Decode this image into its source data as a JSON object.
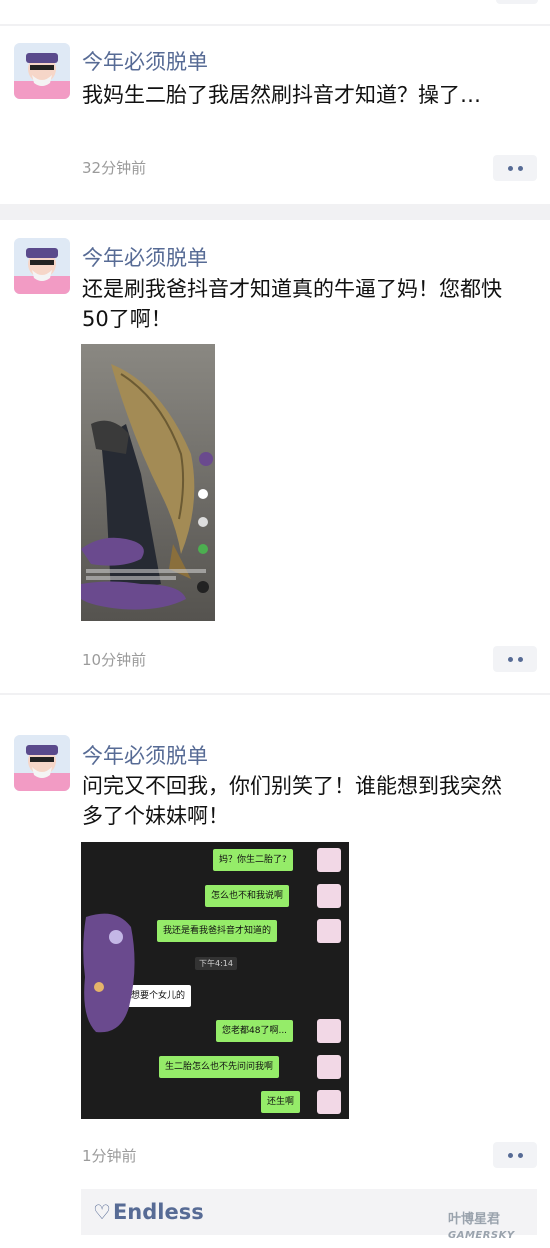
{
  "posts": [
    {
      "nickname": "今年必须脱单",
      "text": "我妈生二胎了我居然刷抖音才知道？操了…",
      "time": "32分钟前"
    },
    {
      "nickname": "今年必须脱单",
      "text": "还是刷我爸抖音才知道真的牛逼了妈！您都快50了啊！",
      "time": "10分钟前"
    },
    {
      "nickname": "今年必须脱单",
      "text": "问完又不回我，你们别笑了！谁能想到我突然多了个妹妹啊！",
      "time": "1分钟前"
    }
  ],
  "chat_screenshot": {
    "time_divider": "下午4:14",
    "messages": [
      {
        "from": "me",
        "text": "妈？你生二胎了?"
      },
      {
        "from": "me",
        "text": "怎么也不和我说啊"
      },
      {
        "from": "me",
        "text": "我还是看我爸抖音才知道的"
      },
      {
        "from": "other",
        "text": "想要个女儿的"
      },
      {
        "from": "me",
        "text": "您老都48了啊..."
      },
      {
        "from": "me",
        "text": "生二胎怎么也不先问问我啊"
      },
      {
        "from": "me",
        "text": "还生啊"
      }
    ]
  },
  "likes": {
    "names": "Endless"
  },
  "watermark": {
    "line1": "叶博星君",
    "line2": "GAMERSKY"
  }
}
